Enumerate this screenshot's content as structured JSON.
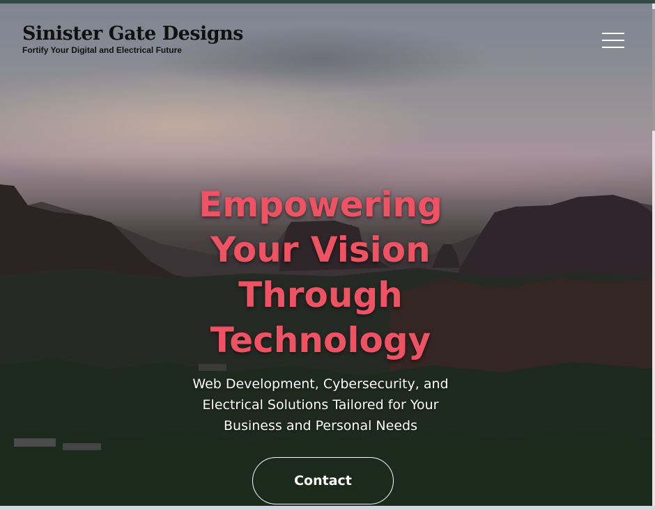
{
  "brand": {
    "name": "Sinister Gate Designs",
    "tagline": "Fortify Your Digital and Electrical Future"
  },
  "nav": {
    "menu_icon": "hamburger-menu-icon"
  },
  "hero": {
    "headline_lines": [
      "Empowering",
      "Your Vision",
      "Through",
      "Technology"
    ],
    "subtitle_lines": [
      "Web Development, Cybersecurity, and",
      "Electrical Solutions Tailored for Your",
      "Business and Personal Needs"
    ],
    "cta_label": "Contact",
    "background": "desert-mountain-sunset-photo"
  },
  "colors": {
    "accent": "#ef5363",
    "header_bar": "#2f4a45",
    "text_light": "#ffffff",
    "brand_text": "#111111"
  }
}
